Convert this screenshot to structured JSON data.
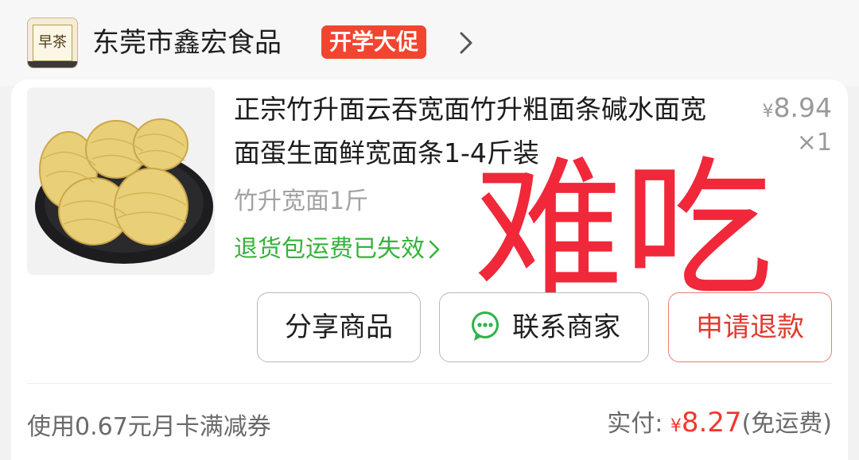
{
  "store": {
    "logo_text": "早茶",
    "name": "东莞市鑫宏食品",
    "promo_badge": "开学大促"
  },
  "order_item": {
    "title": "正宗竹升面云吞宽面竹升粗面条碱水面宽面蛋生面鲜宽面条1-4斤装",
    "price_currency": "¥",
    "price_value": "8.94",
    "quantity": "×1",
    "variant": "竹升宽面1斤",
    "shipping_note": "退货包运费已失效"
  },
  "overlay": {
    "text": "难吃",
    "color": "#f0283a"
  },
  "actions": {
    "share_label": "分享商品",
    "contact_label": "联系商家",
    "refund_label": "申请退款"
  },
  "footer": {
    "coupon_text": "使用0.67元月卡满减券",
    "paid_label": "实付:",
    "paid_currency": "¥",
    "paid_value": "8.27",
    "paid_note": "(免运费)"
  },
  "colors": {
    "promo_red": "#f2452f",
    "shipping_green": "#35b33a",
    "price_red": "#f1382e",
    "wechat_green": "#2fb34a"
  },
  "icons": {
    "store_chevron": "chevron-right-icon",
    "shipping_chevron": "chevron-right-icon",
    "contact": "chat-bubble-icon"
  }
}
